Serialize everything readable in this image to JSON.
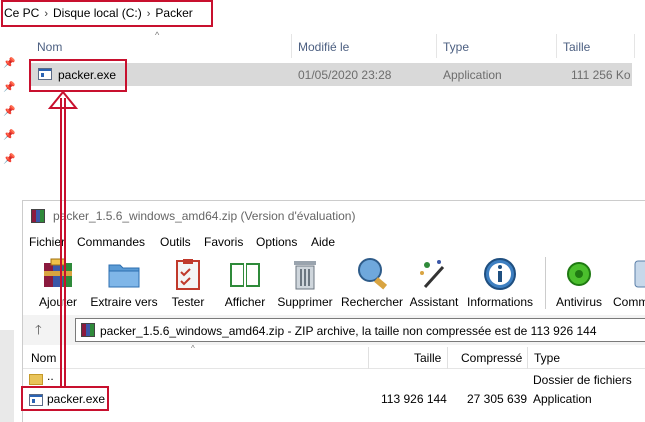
{
  "explorer": {
    "breadcrumb": [
      "Ce PC",
      "Disque local (C:)",
      "Packer"
    ],
    "breadcrumb_sep": "›",
    "columns": [
      "Nom",
      "Modifié le",
      "Type",
      "Taille"
    ],
    "row": {
      "name": "packer.exe",
      "modified": "01/05/2020 23:28",
      "type": "Application",
      "size": "111 256 Ko"
    }
  },
  "winrar": {
    "title": "packer_1.5.6_windows_amd64.zip (Version d'évaluation)",
    "menu": [
      "Fichier",
      "Commandes",
      "Outils",
      "Favoris",
      "Options",
      "Aide"
    ],
    "toolbar": [
      "Ajouter",
      "Extraire vers",
      "Tester",
      "Afficher",
      "Supprimer",
      "Rechercher",
      "Assistant",
      "Informations",
      "Antivirus",
      "Comm"
    ],
    "address": "packer_1.5.6_windows_amd64.zip - ZIP archive, la taille non compressée est de 113 926 144",
    "columns": [
      "Nom",
      "Taille",
      "Compressé",
      "Type"
    ],
    "rows": [
      {
        "name": "..",
        "size": "",
        "compressed": "",
        "type": "Dossier de fichiers"
      },
      {
        "name": "packer.exe",
        "size": "113 926 144",
        "compressed": "27 305 639",
        "type": "Application"
      }
    ]
  },
  "colors": {
    "highlight": "#c8102e",
    "selected_row": "#d9d9d9"
  }
}
